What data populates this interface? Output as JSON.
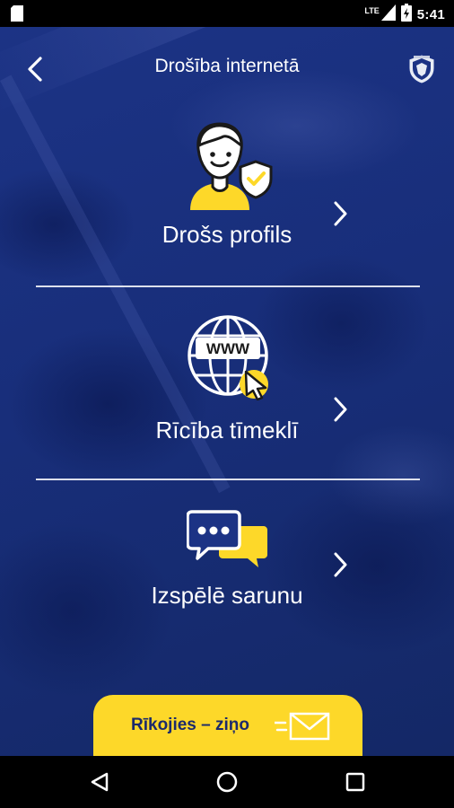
{
  "status_bar": {
    "network": "LTE",
    "time": "5:41",
    "icons": [
      "sim-card-icon",
      "signal-icon",
      "battery-icon"
    ]
  },
  "app_bar": {
    "title": "Drošība internetā",
    "back_icon": "chevron-left-icon",
    "logo_icon": "police-emblem-icon"
  },
  "menu": {
    "items": [
      {
        "label": "Drošs profils",
        "icon": "user-shield-icon"
      },
      {
        "label": "Rīcība tīmeklī",
        "icon": "www-globe-icon",
        "icon_text": "WWW"
      },
      {
        "label": "Izspēlē sarunu",
        "icon": "chat-bubbles-icon"
      }
    ],
    "chevron_icon": "chevron-right-icon"
  },
  "report_button": {
    "label": "Rīkojies – ziņo",
    "icon": "envelope-icon"
  },
  "nav_bar": {
    "buttons": [
      "back-triangle-icon",
      "home-circle-icon",
      "recents-square-icon"
    ]
  },
  "colors": {
    "background_blue": "#1a3080",
    "accent_yellow": "#fdd829",
    "text_white": "#ffffff",
    "button_text": "#1c2a6b"
  }
}
